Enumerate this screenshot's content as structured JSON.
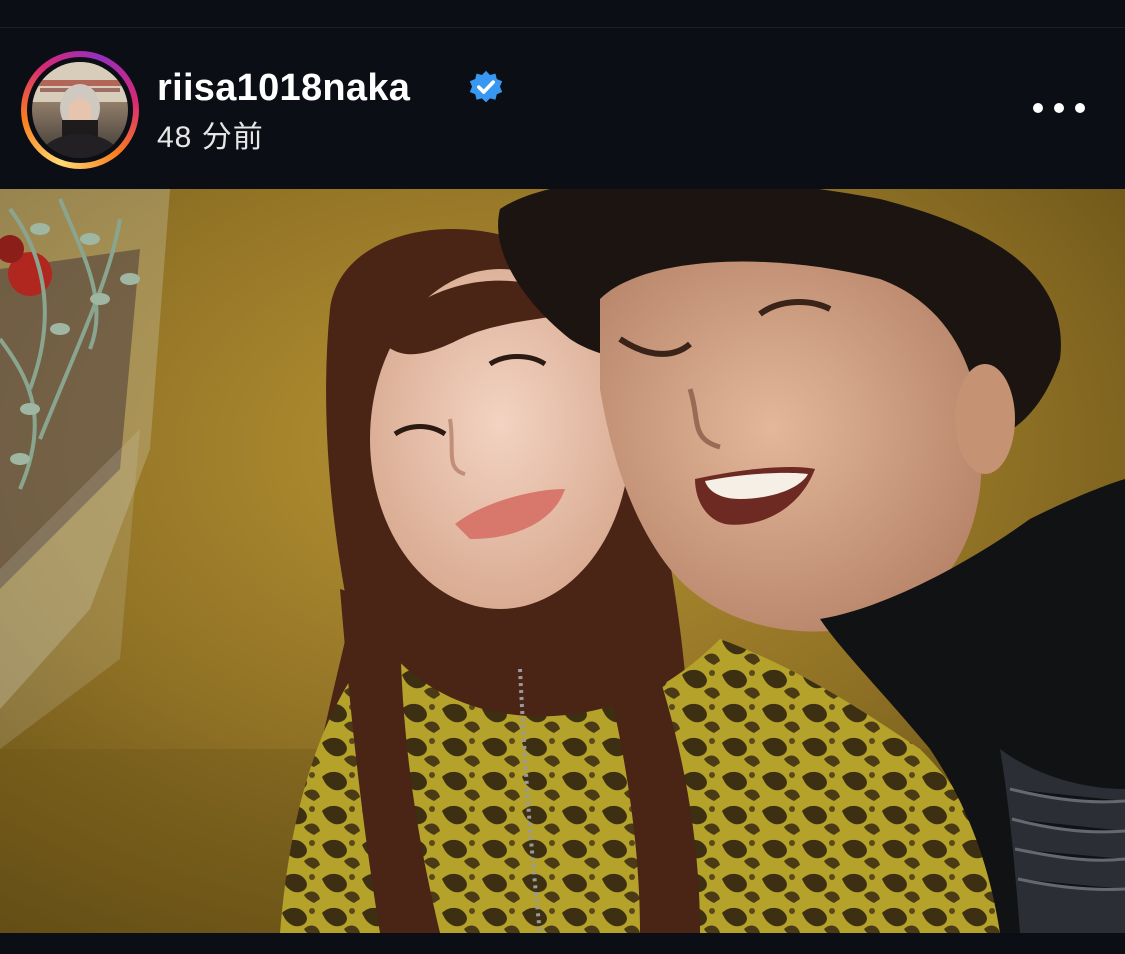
{
  "post": {
    "username": "riisa1018naka",
    "verified": true,
    "timestamp": "48 分前",
    "more_icon": "more-horizontal-icon"
  },
  "colors": {
    "background": "#0b0e15",
    "text": "#ffffff",
    "verified_badge": "#3897f0"
  }
}
